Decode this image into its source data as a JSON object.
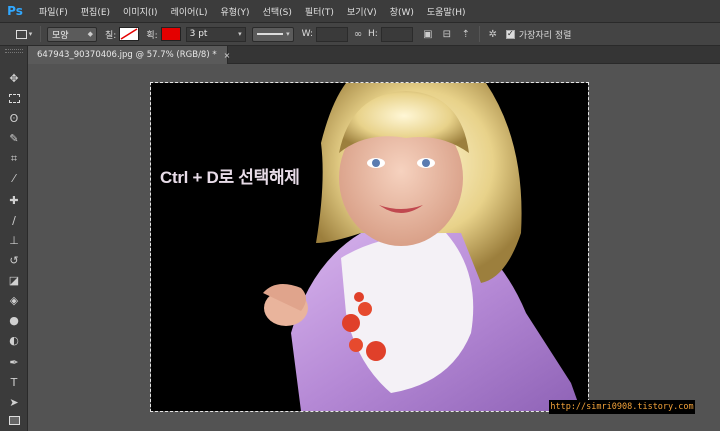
{
  "app": {
    "logo": "Ps"
  },
  "menu": [
    "파일(F)",
    "편집(E)",
    "이미지(I)",
    "레이어(L)",
    "유형(Y)",
    "선택(S)",
    "필터(T)",
    "보기(V)",
    "창(W)",
    "도움말(H)"
  ],
  "options": {
    "shape_mode": "모양",
    "fill_label": "칠:",
    "stroke_label": "획:",
    "stroke_color": "#e40000",
    "stroke_size": "3 pt",
    "w_label": "W:",
    "h_label": "H:",
    "align_edges_label": "가장자리 정렬",
    "align_edges_checked": true
  },
  "document": {
    "tab_title": "647943_90370406.jpg @ 57.7% (RGB/8) *",
    "close_glyph": "×"
  },
  "canvas": {
    "caption": "Ctrl + D로 선택해제",
    "watermark": "http://simri0908.tistory.com"
  },
  "icons": {
    "move": "move-icon",
    "marquee": "rect-marquee-icon",
    "lasso": "lasso-icon",
    "quick_select": "quick-select-icon",
    "crop": "crop-icon",
    "eyedropper": "eyedropper-icon",
    "healing": "healing-brush-icon",
    "brush": "brush-icon",
    "stamp": "clone-stamp-icon",
    "history_brush": "history-brush-icon",
    "eraser": "eraser-icon",
    "bucket": "paint-bucket-icon",
    "blur": "blur-icon",
    "dodge": "dodge-icon",
    "pen": "pen-icon",
    "type": "type-icon",
    "path_select": "path-select-icon",
    "shape": "rectangle-shape-icon"
  }
}
